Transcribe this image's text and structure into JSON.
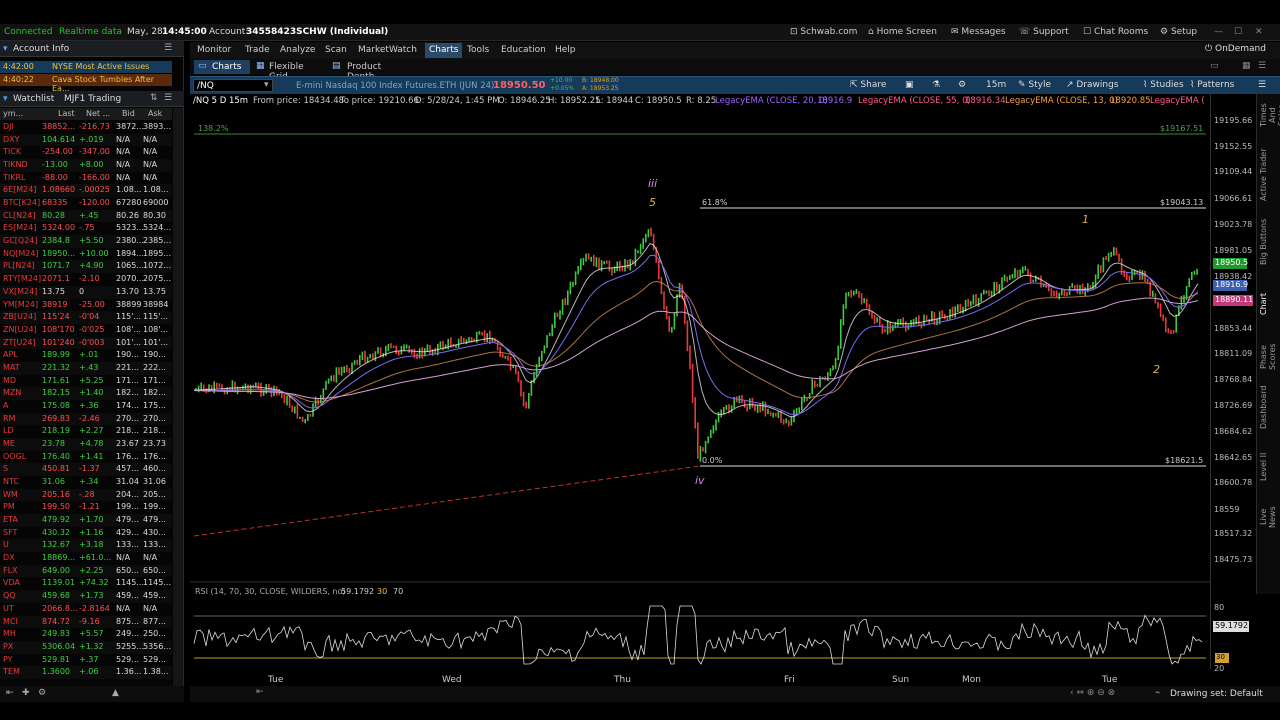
{
  "status": {
    "connected": "Connected",
    "realtime": "Realtime data",
    "date": "May, 28",
    "time": "14:45:00",
    "account_label": "Account:",
    "account": "34558423SCHW (Individual)"
  },
  "toplinks": [
    "Schwab.com",
    "Home Screen",
    "Messages",
    "Support",
    "Chat Rooms",
    "Setup"
  ],
  "account_info": "Account Info",
  "news": [
    {
      "t": "4:42:00",
      "h": "NYSE Most Active Issues"
    },
    {
      "t": "4:40:22",
      "h": "Cava Stock Tumbles After Ea..."
    }
  ],
  "watchlist": {
    "label": "Watchlist",
    "name": "MJF1 Trading",
    "cols": [
      "ym...",
      "Last",
      "Net ...",
      "Bid",
      "Ask"
    ],
    "rows": [
      [
        "DJI",
        "38852...",
        "-216.73",
        "3872...",
        "3893..."
      ],
      [
        "DXY",
        "104.614",
        "+.019",
        "N/A",
        "N/A"
      ],
      [
        "TICK",
        "-254.00",
        "-347.00",
        "N/A",
        "N/A"
      ],
      [
        "TIKND",
        "-13.00",
        "+8.00",
        "N/A",
        "N/A"
      ],
      [
        "TIKRL",
        "-88.00",
        "-166.00",
        "N/A",
        "N/A"
      ],
      [
        "6E[M24]",
        "1.08660",
        "-.00025",
        "1.08...",
        "1.08..."
      ],
      [
        "BTC[K24]",
        "68335",
        "-120.00",
        "67280",
        "69000"
      ],
      [
        "CL[N24]",
        "80.28",
        "+.45",
        "80.26",
        "80.30"
      ],
      [
        "ES[M24]",
        "5324.00",
        "-.75",
        "5323...",
        "5324..."
      ],
      [
        "GC[Q24]",
        "2384.8",
        "+5.50",
        "2380...",
        "2385..."
      ],
      [
        "NQ[M24]",
        "18950...",
        "+10.00",
        "1894...",
        "1895..."
      ],
      [
        "PL[N24]",
        "1071.7",
        "+4.90",
        "1065...",
        "1072..."
      ],
      [
        "RTY[M24]",
        "2071.1",
        "-2.10",
        "2070...",
        "2075..."
      ],
      [
        "VX[M24]",
        "13.75",
        "0",
        "13.70",
        "13.75"
      ],
      [
        "YM[M24]",
        "38919",
        "-25.00",
        "38899",
        "38984"
      ],
      [
        "ZB[U24]",
        "115'24",
        "-0'04",
        "115'...",
        "115'..."
      ],
      [
        "ZN[U24]",
        "108'170",
        "-0'025",
        "108'...",
        "108'..."
      ],
      [
        "ZT[U24]",
        "101'240",
        "-0'003",
        "101'...",
        "101'..."
      ],
      [
        "APL",
        "189.99",
        "+.01",
        "190...",
        "190..."
      ],
      [
        "MAT",
        "221.32",
        "+.43",
        "221...",
        "222..."
      ],
      [
        "MD",
        "171.61",
        "+5.25",
        "171...",
        "171..."
      ],
      [
        "MZN",
        "182.15",
        "+1.40",
        "182...",
        "182..."
      ],
      [
        "A",
        "175.08",
        "+.36",
        "174...",
        "175..."
      ],
      [
        "RM",
        "269.83",
        "-2.46",
        "270...",
        "270..."
      ],
      [
        "LD",
        "218.19",
        "+2.27",
        "218...",
        "218..."
      ],
      [
        "ME",
        "23.78",
        "+4.78",
        "23.67",
        "23.73"
      ],
      [
        "OOGL",
        "176.40",
        "+1.41",
        "176...",
        "176..."
      ],
      [
        "S",
        "450.81",
        "-1.37",
        "457...",
        "460..."
      ],
      [
        "NTC",
        "31.06",
        "+.34",
        "31.04",
        "31.06"
      ],
      [
        "WM",
        "205.16",
        "-.28",
        "204...",
        "205..."
      ],
      [
        "PM",
        "199.50",
        "-1.21",
        "199...",
        "199..."
      ],
      [
        "ETA",
        "479.92",
        "+1.70",
        "479...",
        "479..."
      ],
      [
        "SFT",
        "430.32",
        "+1.16",
        "429...",
        "430..."
      ],
      [
        "U",
        "132.67",
        "+3.18",
        "133...",
        "133..."
      ],
      [
        "DX",
        "18869...",
        "+61.0...",
        "N/A",
        "N/A"
      ],
      [
        "FLX",
        "649.00",
        "+2.25",
        "650...",
        "650..."
      ],
      [
        "VDA",
        "1139.01",
        "+74.32",
        "1145...",
        "1145..."
      ],
      [
        "QQ",
        "459.68",
        "+1.73",
        "459...",
        "459..."
      ],
      [
        "UT",
        "2066.8...",
        "-2.8164",
        "N/A",
        "N/A"
      ],
      [
        "MCI",
        "874.72",
        "-9.16",
        "875...",
        "877..."
      ],
      [
        "MH",
        "249.83",
        "+5.57",
        "249...",
        "250..."
      ],
      [
        "PX",
        "5306.04",
        "+1.32",
        "5255...",
        "5356..."
      ],
      [
        "PY",
        "529.81",
        "+.37",
        "529...",
        "529..."
      ],
      [
        "TEM",
        "1.3600",
        "+.06",
        "1.36...",
        "1.38..."
      ]
    ]
  },
  "menu": [
    "Monitor",
    "Trade",
    "Analyze",
    "Scan",
    "MarketWatch",
    "Charts",
    "Tools",
    "Education",
    "Help"
  ],
  "ondemand": "OnDemand",
  "tabs": [
    "Charts",
    "Flexible Grid",
    "Product Depth"
  ],
  "symbol": {
    "value": "/NQ",
    "desc": "E-mini Nasdaq 100 Index Futures.ETH (JUN 24)",
    "price": "18950.50",
    "chg": "+10.00",
    "pct": "+0.05%",
    "bid": "B: 18948.00",
    "ask": "A: 18953.25",
    "interval": "15m"
  },
  "toolbar": [
    "Share",
    "Style",
    "Drawings",
    "Studies",
    "Patterns"
  ],
  "study_line": {
    "head": "/NQ 5 D 15m",
    "from": "From price: 18434.48",
    "to": "To price: 19210.66",
    "d": "D: 5/28/24, 1:45 PM",
    "o": "O: 18946.25",
    "h": "H: 18952.25",
    "l": "L: 18944",
    "c": "C: 18950.5",
    "r": "R: 8.25",
    "ema20": "LegacyEMA (CLOSE, 20, 0)",
    "ema20v": "18916.9",
    "ema55": "LegacyEMA (CLOSE, 55, 0)",
    "ema55v": "18916.34",
    "ema13": "LegacyEMA (CLOSE, 13, 0)",
    "ema13v": "18920.85",
    "ema_more": "LegacyEMA ("
  },
  "annotations": {
    "pct_top": "138.2%",
    "fib618": "61.8%",
    "fib0": "0.0%",
    "lvl_top": "$19167.51",
    "lvl_mid": "$19043.13",
    "lvl_low": "$18621.5",
    "w_iii": "iii",
    "w_5": "5",
    "w_iv": "iv",
    "w_1": "1",
    "w_2": "2"
  },
  "price_axis": [
    "19195.66",
    "19152.55",
    "19109.44",
    "19066.61",
    "19023.78",
    "18981.05",
    "18938.42",
    "18853.44",
    "18811.09",
    "18768.84",
    "18726.69",
    "18684.62",
    "18642.65",
    "18600.78",
    "18559",
    "18517.32",
    "18475.73"
  ],
  "price_tags": [
    {
      "v": "18950.5",
      "c": "#1e9a2e"
    },
    {
      "v": "18916.9",
      "c": "#3c5fb0"
    },
    {
      "v": "18890.11",
      "c": "#c03a7a"
    }
  ],
  "rsi": {
    "label": "RSI (14, 70, 30, CLOSE, WILDERS, no)",
    "value": "59.1792",
    "hi": "30",
    "lo": "70",
    "ax80": "80",
    "ax20": "20",
    "tag": "59.1792",
    "tag30": "30"
  },
  "days": [
    "Tue",
    "Wed",
    "Thu",
    "Fri",
    "Sun",
    "Mon",
    "Tue"
  ],
  "side_tabs": [
    "Times And Sales",
    "Active Trader",
    "Big Buttons",
    "Chart",
    "Phase Scores",
    "Dashboard",
    "Level II",
    "Live News"
  ],
  "drawing_set": "Drawing set: Default"
}
